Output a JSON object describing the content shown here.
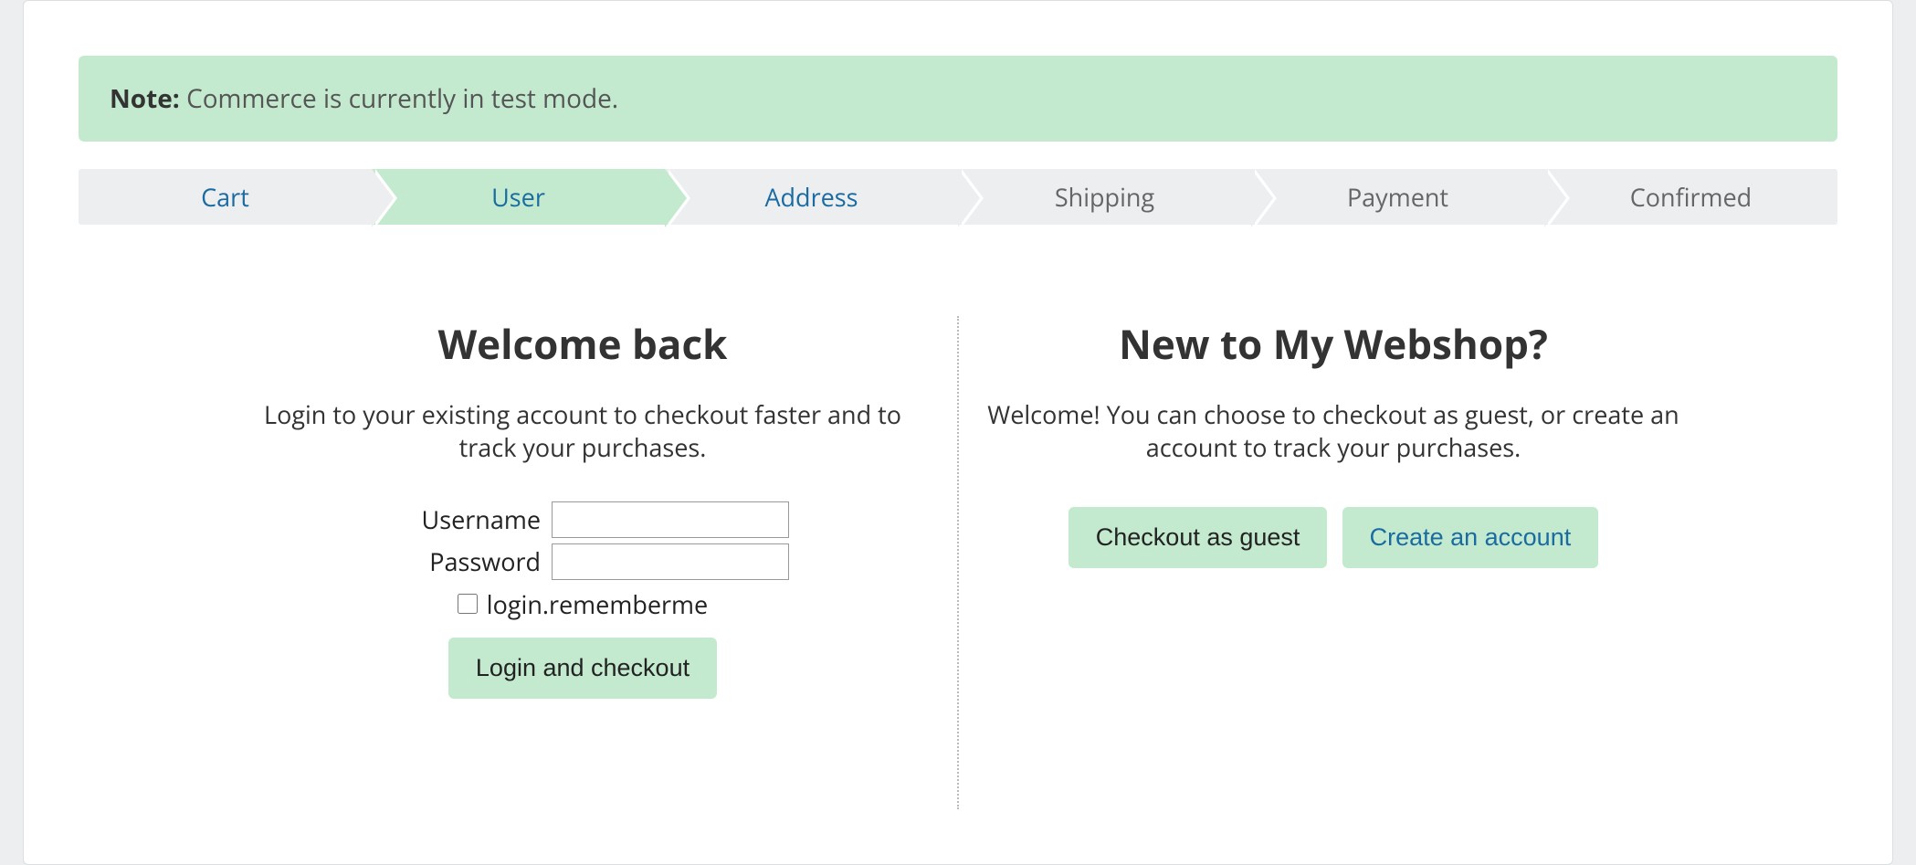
{
  "alert": {
    "prefix": "Note:",
    "message": "Commerce is currently in test mode."
  },
  "steps": {
    "cart": "Cart",
    "user": "User",
    "address": "Address",
    "shipping": "Shipping",
    "payment": "Payment",
    "confirmed": "Confirmed"
  },
  "login": {
    "heading": "Welcome back",
    "lead": "Login to your existing account to checkout faster and to track your purchases.",
    "username_label": "Username",
    "password_label": "Password",
    "remember_label": "login.rememberme",
    "submit_label": "Login and checkout"
  },
  "guest": {
    "heading": "New to My Webshop?",
    "lead": "Welcome! You can choose to checkout as guest, or create an account to track your purchases.",
    "checkout_guest_label": "Checkout as guest",
    "create_account_label": "Create an account"
  }
}
